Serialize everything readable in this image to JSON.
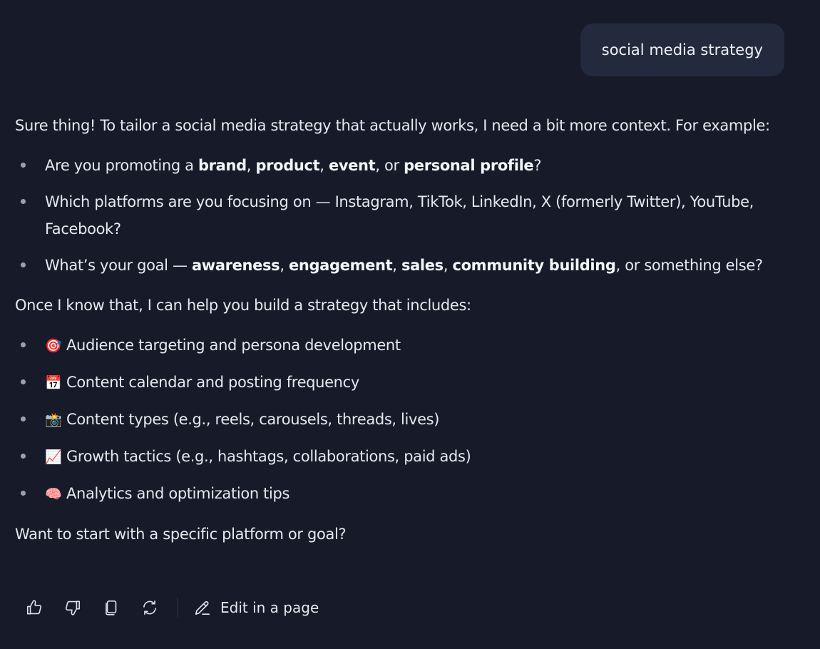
{
  "user_message": "social media strategy",
  "reply": {
    "intro": "Sure thing! To tailor a social media strategy that actually works, I need a bit more context. For example:",
    "questions": {
      "q1": {
        "prefix": "Are you promoting a ",
        "b1": "brand",
        "s1": ", ",
        "b2": "product",
        "s2": ", ",
        "b3": "event",
        "s3": ", or ",
        "b4": "personal profile",
        "suffix": "?"
      },
      "q2": {
        "text": "Which platforms are you focusing on — Instagram, TikTok, LinkedIn, X (formerly Twitter), YouTube, Facebook?"
      },
      "q3": {
        "prefix": "What’s your goal — ",
        "b1": "awareness",
        "s1": ", ",
        "b2": "engagement",
        "s2": ", ",
        "b3": "sales",
        "s3": ", ",
        "b4": "community building",
        "suffix": ", or something else?"
      }
    },
    "mid": "Once I know that, I can help you build a strategy that includes:",
    "features": [
      {
        "emoji": "🎯",
        "text": "Audience targeting and persona development"
      },
      {
        "emoji": "📅",
        "text": "Content calendar and posting frequency"
      },
      {
        "emoji": "📸",
        "text": "Content types (e.g., reels, carousels, threads, lives)"
      },
      {
        "emoji": "📈",
        "text": "Growth tactics (e.g., hashtags, collaborations, paid ads)"
      },
      {
        "emoji": "🧠",
        "text": "Analytics and optimization tips"
      }
    ],
    "closing": "Want to start with a specific platform or goal?"
  },
  "actions": {
    "edit_label": "Edit in a page",
    "icons": [
      "thumbs-up-icon",
      "thumbs-down-icon",
      "copy-icon",
      "regenerate-icon",
      "pencil-icon"
    ]
  },
  "colors": {
    "background": "#171b29",
    "user_bubble": "#242a3e",
    "text": "#e6e8ef",
    "bullet": "#9aa1b6"
  }
}
